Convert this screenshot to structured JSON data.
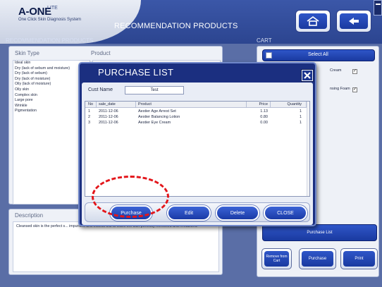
{
  "header": {
    "logo_main": "A-ONE",
    "logo_superscript": "LITE",
    "logo_subtitle": "One Click Skin Diagnosis System",
    "page_title": "RECOMMENDATION PRODUCTS",
    "home_icon": "home-icon",
    "back_icon": "back-arrow-icon"
  },
  "recommendation": {
    "section_title": "RECOMMENDATION PRODUCTS",
    "skin_type_header": "Skin Type",
    "product_header": "Product",
    "skin_types": [
      "Ideal skin",
      "Dry (lack of sebum and moisture)",
      "Dry (lack of sebum)",
      "Dry (lack of moisture)",
      "Oily (lack of moisture)",
      "Oily skin",
      "Complex skin",
      "Large pore",
      "Wrinkle",
      "Pigmentation"
    ]
  },
  "description": {
    "title": "Description",
    "text": "Cleansed skin is the perfect s... impurities and excess oils to leave the skin perfectly refreshed and revitalised."
  },
  "cart": {
    "section_title": "CART",
    "select_all_label": "Select All",
    "items": [
      {
        "name": "Cream",
        "checked": true
      },
      {
        "name": "nsing Foam",
        "checked": true
      }
    ],
    "purchase_list_label": "Purchase List",
    "remove_label": "Remove from Cart",
    "purchase_label": "Purchase",
    "print_label": "Print"
  },
  "dialog": {
    "title": "PURCHASE LIST",
    "close_icon": "close-icon",
    "cust_name_label": "Cust Name",
    "cust_name_value": "Test",
    "columns": [
      "No",
      "sale_date",
      "Product",
      "Price",
      "Quantity"
    ],
    "rows": [
      {
        "no": "1",
        "sale_date": "2011-12-06",
        "product": "Aestier Age Arrest Set",
        "price": "1.13",
        "quantity": "1"
      },
      {
        "no": "2",
        "sale_date": "2011-12-06",
        "product": "Aestier Balancing Lotion",
        "price": "0.80",
        "quantity": "1"
      },
      {
        "no": "3",
        "sale_date": "2011-12-06",
        "product": "Aestier Eye Cream",
        "price": "0.00",
        "quantity": "1"
      }
    ],
    "buttons": {
      "purchase": "Purchase",
      "edit": "Edit",
      "delete": "Delete",
      "close": "CLOSE"
    }
  },
  "colors": {
    "accent_blue": "#1a3aa0",
    "highlight_red": "#e3161b",
    "background": "#5a6ea6"
  }
}
